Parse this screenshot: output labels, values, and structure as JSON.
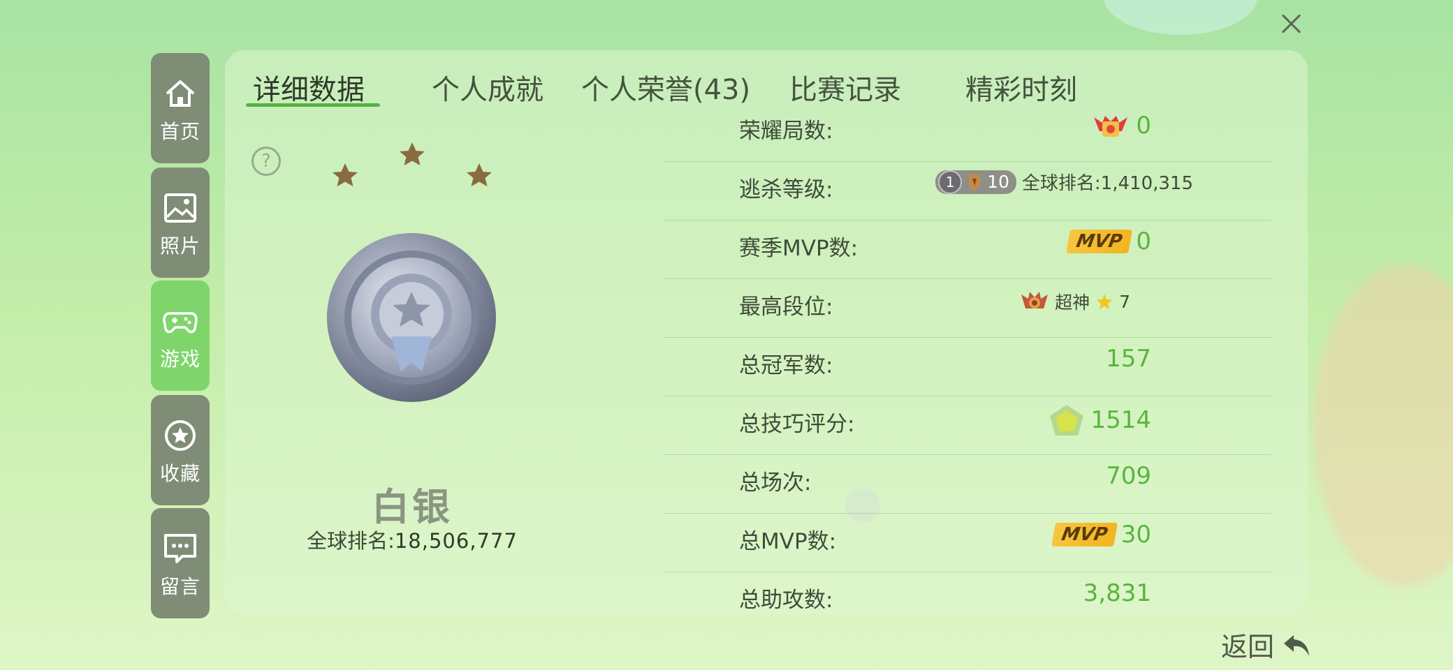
{
  "sidebar": {
    "items": [
      {
        "label": "首页",
        "icon": "home-icon"
      },
      {
        "label": "照片",
        "icon": "photo-icon"
      },
      {
        "label": "游戏",
        "icon": "gamepad-icon"
      },
      {
        "label": "收藏",
        "icon": "star-icon"
      },
      {
        "label": "留言",
        "icon": "message-icon"
      }
    ],
    "active_index": 2
  },
  "tabs": [
    {
      "label": "详细数据"
    },
    {
      "label": "个人成就"
    },
    {
      "label": "个人荣誉(43)"
    },
    {
      "label": "比赛记录"
    },
    {
      "label": "精彩时刻"
    }
  ],
  "active_tab": 0,
  "rank": {
    "name": "白银",
    "global_label": "全球排名:",
    "global_value": "18,506,777",
    "stars": 3
  },
  "stats": [
    {
      "label": "荣耀局数:",
      "value": "0",
      "icon": "honor-crest-icon"
    },
    {
      "label": "逃杀等级:",
      "level": "1",
      "badge_value": "10",
      "global_label": "全球排名:",
      "global_value": "1,410,315"
    },
    {
      "label": "赛季MVP数:",
      "mvp_tag": "MVP",
      "value": "0"
    },
    {
      "label": "最高段位:",
      "tier_name": "超神",
      "tier_stars": "7"
    },
    {
      "label": "总冠军数:",
      "value": "157"
    },
    {
      "label": "总技巧评分:",
      "value": "1514",
      "icon": "pentagon-score-icon"
    },
    {
      "label": "总场次:",
      "value": "709"
    },
    {
      "label": "总MVP数:",
      "mvp_tag": "MVP",
      "value": "30"
    },
    {
      "label": "总助攻数:",
      "value": "3,831"
    }
  ],
  "back_label": "返回",
  "colors": {
    "accent_green": "#58b53d",
    "sidebar_active": "#7fd56c",
    "sidebar_default": "#7f8c76",
    "mvp_gold": "#f3b41f"
  }
}
